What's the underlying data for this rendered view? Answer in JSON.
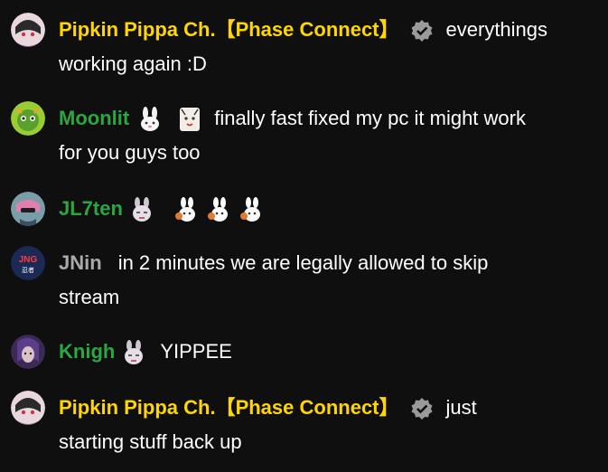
{
  "messages": [
    {
      "author": "Pipkin Pippa Ch.【Phase Connect】",
      "line1": "everythings",
      "line2": "working again :D"
    },
    {
      "author": "Moonlit",
      "line1": "finally fast fixed my pc it might work",
      "line2": "for you guys too"
    },
    {
      "author": "JL7ten"
    },
    {
      "author": "JNin",
      "line1": "in 2 minutes we are legally allowed to skip",
      "line2": "stream"
    },
    {
      "author": "Knigh",
      "line1": "YIPPEE"
    },
    {
      "author": "Pipkin Pippa Ch.【Phase Connect】",
      "line1": "just",
      "line2": "starting stuff back up"
    }
  ],
  "colors": {
    "background": "#0f0f0f",
    "owner_name": "#ffd600",
    "member_name": "#2ba640",
    "regular_name": "#aaaaaa"
  },
  "icons": {
    "verified_badge": "verified-badge-icon",
    "emotes": [
      "bunny-emote",
      "cat-emote",
      "rabbit-emote",
      "pippa-emote"
    ]
  }
}
